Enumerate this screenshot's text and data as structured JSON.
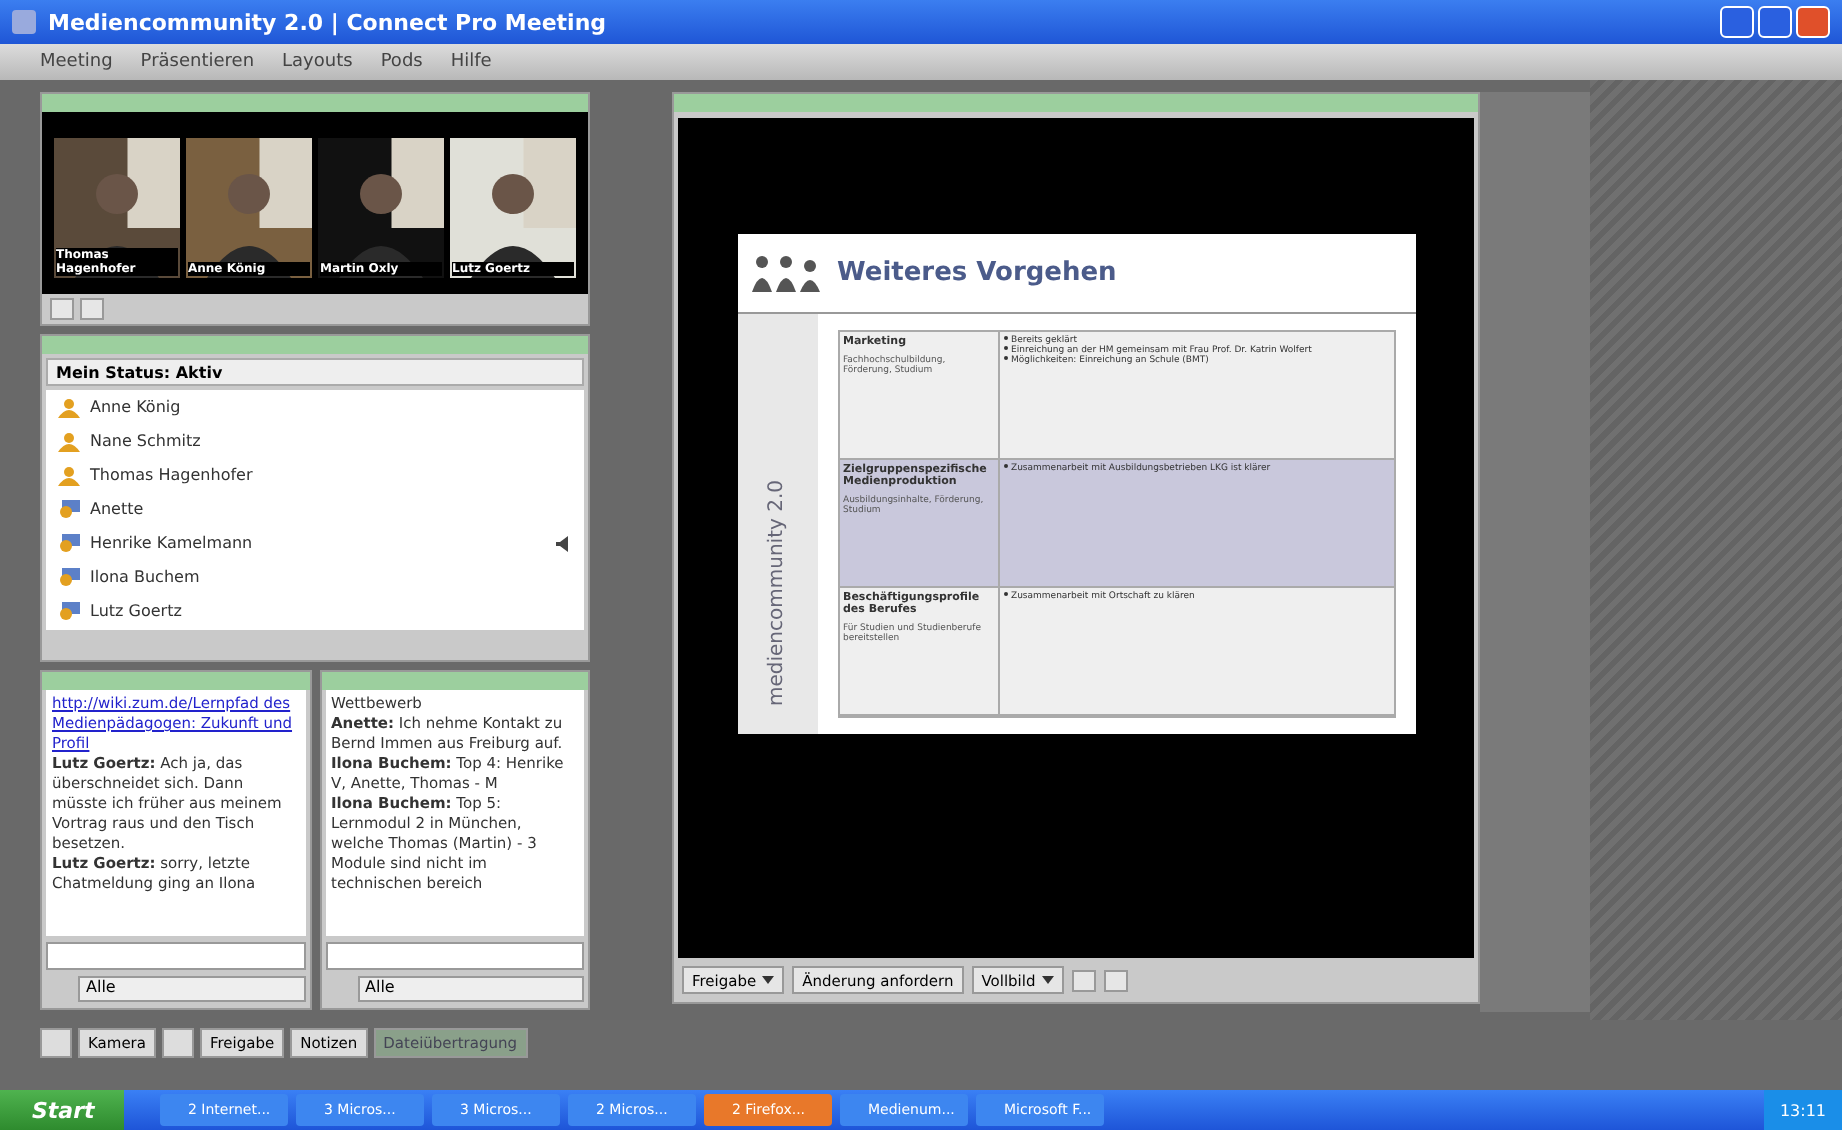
{
  "window": {
    "title": "Mediencommunity 2.0 | Connect Pro Meeting"
  },
  "menu": [
    "Meeting",
    "Präsentieren",
    "Layouts",
    "Pods",
    "Hilfe"
  ],
  "video_feeds": [
    {
      "name": "Thomas Hagenhofer"
    },
    {
      "name": "Anne König"
    },
    {
      "name": "Martin Oxly"
    },
    {
      "name": "Lutz Goertz"
    }
  ],
  "attendees": {
    "status": "Mein Status: Aktiv",
    "list": [
      {
        "name": "Anne König",
        "kind": "host",
        "speaking": false
      },
      {
        "name": "Nane Schmitz",
        "kind": "host",
        "speaking": false
      },
      {
        "name": "Thomas Hagenhofer",
        "kind": "host",
        "speaking": false
      },
      {
        "name": "Anette",
        "kind": "participant",
        "speaking": false
      },
      {
        "name": "Henrike Kamelmann",
        "kind": "participant",
        "speaking": true
      },
      {
        "name": "Ilona Buchem",
        "kind": "participant",
        "speaking": false
      },
      {
        "name": "Lutz Goertz",
        "kind": "participant",
        "speaking": false
      }
    ]
  },
  "chats": [
    {
      "recipient": "Alle",
      "messages": [
        {
          "kind": "link",
          "text": "http://wiki.zum.de/Lernpfad des Medienpädagogen: Zukunft und Profil"
        },
        {
          "kind": "message",
          "sender": "Lutz Goertz:",
          "text": "Ach ja, das überschneidet sich. Dann müsste ich früher aus meinem Vortrag raus und den Tisch besetzen."
        },
        {
          "kind": "message",
          "sender": "Lutz Goertz:",
          "text": "sorry, letzte Chatmeldung ging an Ilona"
        }
      ]
    },
    {
      "recipient": "Alle",
      "messages": [
        {
          "kind": "text",
          "text": "Wettbewerb"
        },
        {
          "kind": "message",
          "sender": "Anette:",
          "text": "Ich nehme Kontakt zu Bernd Immen aus Freiburg auf."
        },
        {
          "kind": "message",
          "sender": "Ilona Buchem:",
          "text": "Top 4: Henrike V, Anette, Thomas - M"
        },
        {
          "kind": "message",
          "sender": "Ilona Buchem:",
          "text": "Top 5: Lernmodul 2 in München, welche Thomas (Martin) - 3 Module sind nicht im technischen bereich"
        }
      ]
    }
  ],
  "slide": {
    "title": "Weiteres Vorgehen",
    "brand": "mediencommunity 2.0",
    "rows": [
      {
        "title": "Marketing",
        "subtitle": "Fachhochschulbildung, Förderung, Studium",
        "highlighted": false,
        "bullets": [
          "Bereits geklärt",
          "Einreichung an der HM gemeinsam mit Frau Prof. Dr. Katrin Wolfert",
          "Möglichkeiten: Einreichung an Schule (BMT)"
        ]
      },
      {
        "title": "Zielgruppenspezifische Medienproduktion",
        "subtitle": "Ausbildungsinhalte, Förderung, Studium",
        "highlighted": true,
        "bullets": [
          "Zusammenarbeit mit Ausbildungsbetrieben LKG ist klärer"
        ]
      },
      {
        "title": "Beschäftigungsprofile des Berufes",
        "subtitle": "Für Studien und Studienberufe bereitstellen",
        "highlighted": false,
        "bullets": [
          "Zusammenarbeit mit Ortschaft zu klären"
        ]
      }
    ]
  },
  "presentation_controls": [
    {
      "kind": "dropdown",
      "label": "Freigabe"
    },
    {
      "kind": "button",
      "label": "Änderung anfordern"
    },
    {
      "kind": "dropdown",
      "label": "Vollbild"
    }
  ],
  "toolbar": [
    {
      "kind": "icon"
    },
    {
      "kind": "tool",
      "label": "Kamera"
    },
    {
      "kind": "icon"
    },
    {
      "kind": "tool",
      "label": "Freigabe"
    },
    {
      "kind": "tool",
      "label": "Notizen"
    },
    {
      "kind": "field",
      "label": "Dateiübertragung"
    }
  ],
  "taskbar": {
    "start": "Start",
    "items": [
      {
        "label": "2 Internet...",
        "selected": false
      },
      {
        "label": "3 Micros...",
        "selected": false
      },
      {
        "label": "3 Micros...",
        "selected": false
      },
      {
        "label": "2 Micros...",
        "selected": false
      },
      {
        "label": "2 Firefox...",
        "selected": true
      },
      {
        "label": "Medienum...",
        "selected": false
      },
      {
        "label": "Microsoft F...",
        "selected": false
      }
    ],
    "clock": "13:11"
  }
}
